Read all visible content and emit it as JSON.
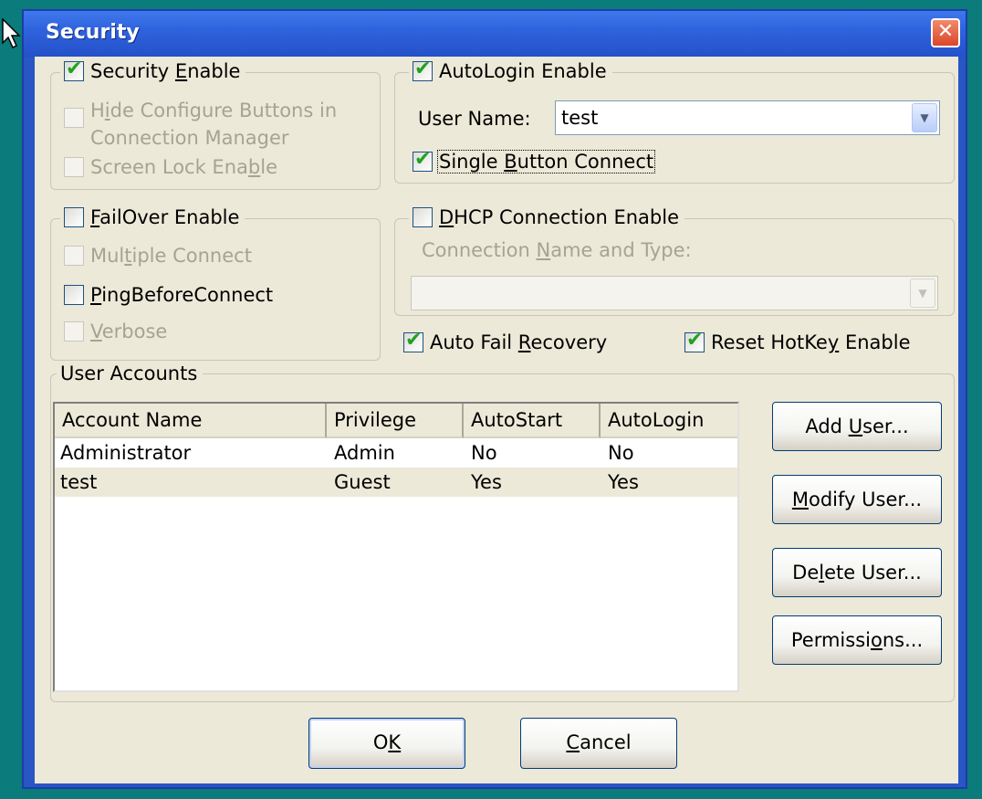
{
  "window": {
    "title": "Security",
    "close_glyph": "✕"
  },
  "security": {
    "enable": {
      "label_pre": "Security ",
      "label_key": "E",
      "label_post": "nable",
      "checked": true
    },
    "hide_configure": {
      "label_pre": "H",
      "label_key": "i",
      "label_post": "de Configure Buttons in Connection Manager",
      "checked": false,
      "enabled": false
    },
    "screen_lock": {
      "label_pre": "Screen Lock Ena",
      "label_key": "b",
      "label_post": "le",
      "checked": false,
      "enabled": false
    }
  },
  "autologin": {
    "enable": {
      "label": "AutoLogin Enable",
      "checked": true
    },
    "user_name_label": "User Name:",
    "user_name_value": "test",
    "single_button": {
      "label_pre": "Single ",
      "label_key": "B",
      "label_post": "utton Connect",
      "checked": true
    }
  },
  "failover": {
    "enable": {
      "label_pre": "",
      "label_key": "F",
      "label_post": "ailOver Enable",
      "checked": false
    },
    "multiple_connect": {
      "label_pre": "Mul",
      "label_key": "t",
      "label_post": "iple Connect",
      "checked": false,
      "enabled": false
    },
    "ping_before": {
      "label_pre": "",
      "label_key": "P",
      "label_post": "ingBeforeConnect",
      "checked": false
    },
    "verbose": {
      "label_pre": "",
      "label_key": "V",
      "label_post": "erbose",
      "checked": false,
      "enabled": false
    }
  },
  "dhcp": {
    "enable": {
      "label_pre": "",
      "label_key": "D",
      "label_post": "HCP Connection Enable",
      "checked": false
    },
    "conn_label_pre": "Connection ",
    "conn_label_key": "N",
    "conn_label_post": "ame and Type:",
    "conn_value": ""
  },
  "auto_fail_recovery": {
    "label_pre": "Auto Fail ",
    "label_key": "R",
    "label_post": "ecovery",
    "checked": true
  },
  "reset_hotkey": {
    "label_pre": "Reset HotKe",
    "label_key": "y",
    "label_post": " Enable",
    "checked": true
  },
  "accounts": {
    "legend": "User Accounts",
    "columns": [
      "Account Name",
      "Privilege",
      "AutoStart",
      "AutoLogin"
    ],
    "rows": [
      [
        "Administrator",
        "Admin",
        "No",
        "No"
      ],
      [
        "test",
        "Guest",
        "Yes",
        "Yes"
      ]
    ],
    "selected_row": 1,
    "buttons": {
      "add": {
        "pre": "Add ",
        "key": "U",
        "post": "ser..."
      },
      "modify": {
        "pre": "",
        "key": "M",
        "post": "odify User..."
      },
      "delete": {
        "pre": "De",
        "key": "l",
        "post": "ete User..."
      },
      "permissions": {
        "pre": "Permissi",
        "key": "o",
        "post": "ns..."
      }
    }
  },
  "footer": {
    "ok": {
      "pre": "O",
      "key": "K",
      "post": ""
    },
    "cancel": {
      "pre": "",
      "key": "C",
      "post": "ancel"
    }
  },
  "colors": {
    "check": "#21a121",
    "title_bar": "#2f63de",
    "desktop": "#0b7b7b"
  }
}
